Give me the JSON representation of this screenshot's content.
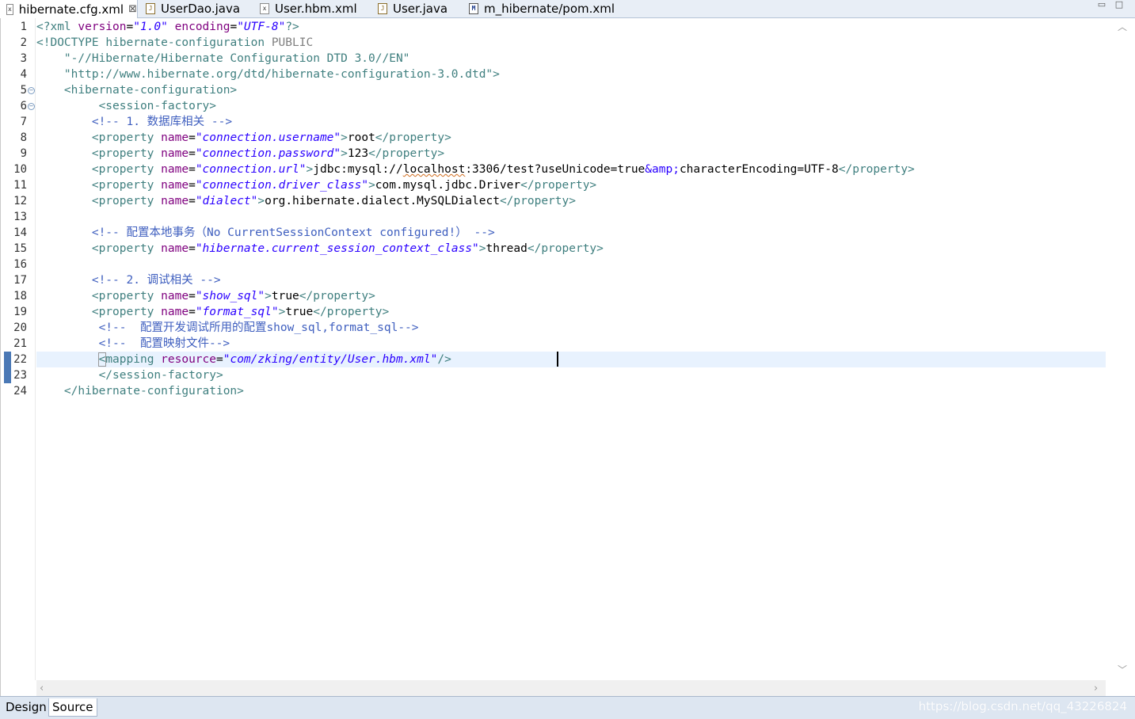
{
  "tabs": [
    {
      "label": "hibernate.cfg.xml",
      "icon": "xml-file-icon",
      "active": true,
      "close": "⊠"
    },
    {
      "label": "UserDao.java",
      "icon": "java-file-icon"
    },
    {
      "label": "User.hbm.xml",
      "icon": "xml-file-icon"
    },
    {
      "label": "User.java",
      "icon": "java-file-icon"
    },
    {
      "label": "m_hibernate/pom.xml",
      "icon": "maven-file-icon"
    }
  ],
  "window_controls": {
    "minimize": "▭",
    "maximize": "□"
  },
  "editor": {
    "line_numbers": [
      "1",
      "2",
      "3",
      "4",
      "5",
      "6",
      "7",
      "8",
      "9",
      "10",
      "11",
      "12",
      "13",
      "14",
      "15",
      "16",
      "17",
      "18",
      "19",
      "20",
      "21",
      "22",
      "23",
      "24"
    ],
    "current_line": 22,
    "code": {
      "l1": {
        "open": "<?",
        "name": "xml ",
        "a1": "version",
        "eq1": "=",
        "v1": "\"1.0\"",
        "sp": " ",
        "a2": "encoding",
        "eq2": "=",
        "v2": "\"UTF-8\"",
        "close": "?>"
      },
      "l2": {
        "open": "<!DOCTYPE ",
        "name": "hibernate-configuration ",
        "kw": "PUBLIC"
      },
      "l3": {
        "indent": "    ",
        "str": "\"-//Hibernate/Hibernate Configuration DTD 3.0//EN\""
      },
      "l4": {
        "indent": "    ",
        "str": "\"http://www.hibernate.org/dtd/hibernate-configuration-3.0.dtd\"",
        "close": ">"
      },
      "l5": {
        "indent": "    ",
        "tag": "<hibernate-configuration>"
      },
      "l6": {
        "indent": "         ",
        "tag": "<session-factory>"
      },
      "l7": {
        "indent": "        ",
        "comment": "<!-- 1. 数据库相关 -->"
      },
      "l8": {
        "indent": "        ",
        "open": "<property ",
        "attr": "name",
        "eq": "=",
        "val": "\"connection.username\"",
        "gt": ">",
        "text": "root",
        "close": "</property>"
      },
      "l9": {
        "indent": "        ",
        "open": "<property ",
        "attr": "name",
        "eq": "=",
        "val": "\"connection.password\"",
        "gt": ">",
        "text": "123",
        "close": "</property>"
      },
      "l10": {
        "indent": "        ",
        "open": "<property ",
        "attr": "name",
        "eq": "=",
        "val": "\"connection.url\"",
        "gt": ">",
        "text_a": "jdbc:mysql://",
        "text_b": "localhost",
        "text_c": ":3306/test?useUnicode=true",
        "entity": "&amp;",
        "text_d": "characterEncoding=UTF-8",
        "close": "</property>"
      },
      "l11": {
        "indent": "        ",
        "open": "<property ",
        "attr": "name",
        "eq": "=",
        "val": "\"connection.driver_class\"",
        "gt": ">",
        "text": "com.mysql.jdbc.Driver",
        "close": "</property>"
      },
      "l12": {
        "indent": "        ",
        "open": "<property ",
        "attr": "name",
        "eq": "=",
        "val": "\"dialect\"",
        "gt": ">",
        "text": "org.hibernate.dialect.MySQLDialect",
        "close": "</property>"
      },
      "l14": {
        "indent": "        ",
        "comment": "<!-- 配置本地事务（No CurrentSessionContext configured!） -->"
      },
      "l15": {
        "indent": "        ",
        "open": "<property ",
        "attr": "name",
        "eq": "=",
        "val": "\"hibernate.current_session_context_class\"",
        "gt": ">",
        "text": "thread",
        "close": "</property>"
      },
      "l17": {
        "indent": "        ",
        "comment": "<!-- 2. 调试相关 -->"
      },
      "l18": {
        "indent": "        ",
        "open": "<property ",
        "attr": "name",
        "eq": "=",
        "val": "\"show_sql\"",
        "gt": ">",
        "text": "true",
        "close": "</property>"
      },
      "l19": {
        "indent": "        ",
        "open": "<property ",
        "attr": "name",
        "eq": "=",
        "val": "\"format_sql\"",
        "gt": ">",
        "text": "true",
        "close": "</property>"
      },
      "l20": {
        "indent": "         ",
        "comment": "<!--  配置开发调试所用的配置show_sql,format_sql-->"
      },
      "l21": {
        "indent": "         ",
        "comment": "<!--  配置映射文件-->"
      },
      "l22": {
        "indent": "         ",
        "lt": "<",
        "name": "mapping ",
        "attr": "resource",
        "eq": "=",
        "val": "\"com/zking/entity/User.hbm.xml\"",
        "close": "/>"
      },
      "l23": {
        "indent": "         ",
        "tag": "</session-factory>"
      },
      "l24": {
        "indent": "    ",
        "tag": "</hibernate-configuration>"
      }
    }
  },
  "page_tabs": [
    {
      "label": "Design"
    },
    {
      "label": "Source",
      "active": true
    }
  ],
  "watermark": "https://blog.csdn.net/qq_43226824",
  "colors": {
    "tag": "#3f7f7f",
    "attribute": "#7f007f",
    "attribute_value": "#2a00ff",
    "comment": "#3f5fbf",
    "current_line": "#e8f2fe",
    "tab_bar": "#e8eef6"
  }
}
